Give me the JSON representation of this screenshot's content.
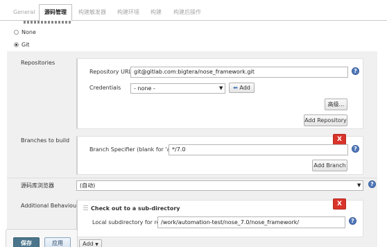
{
  "tabs": [
    {
      "label": "General"
    },
    {
      "label": "源码管理"
    },
    {
      "label": "构建触发器"
    },
    {
      "label": "构建环境"
    },
    {
      "label": "构建"
    },
    {
      "label": "构建后操作"
    }
  ],
  "scm": {
    "options": [
      {
        "label": "None",
        "selected": false
      },
      {
        "label": "Git",
        "selected": true
      }
    ]
  },
  "repositories": {
    "section_label": "Repositories",
    "url_label": "Repository URL",
    "url_value": "git@gitlab.com:bigtera/nose_framework.git",
    "credentials_label": "Credentials",
    "credentials_value": "- none -",
    "add_credential_label": "Add",
    "advanced_label": "高级...",
    "add_repository_label": "Add Repository"
  },
  "branches": {
    "section_label": "Branches to build",
    "specifier_label": "Branch Specifier (blank for 'any')",
    "specifier_value": "*/7.0",
    "delete_label": "X",
    "add_branch_label": "Add Branch"
  },
  "browser": {
    "section_label": "源码库浏览器",
    "value": "(自动)"
  },
  "behaviours": {
    "section_label": "Additional Behaviours",
    "item_title": "Check out to a sub-directory",
    "delete_label": "X",
    "subdir_label": "Local subdirectory for repo",
    "subdir_value": "/work/automation-test/nose_7.0/nose_framework/",
    "add_label": "Add"
  },
  "footer": {
    "save_label": "保存",
    "apply_label": "应用"
  },
  "help_label": "?",
  "colors": {
    "save_button": "#4b758b",
    "delete_button": "#d9342b",
    "help_icon": "#5077b8",
    "panel_background": "#f0f0f0"
  }
}
